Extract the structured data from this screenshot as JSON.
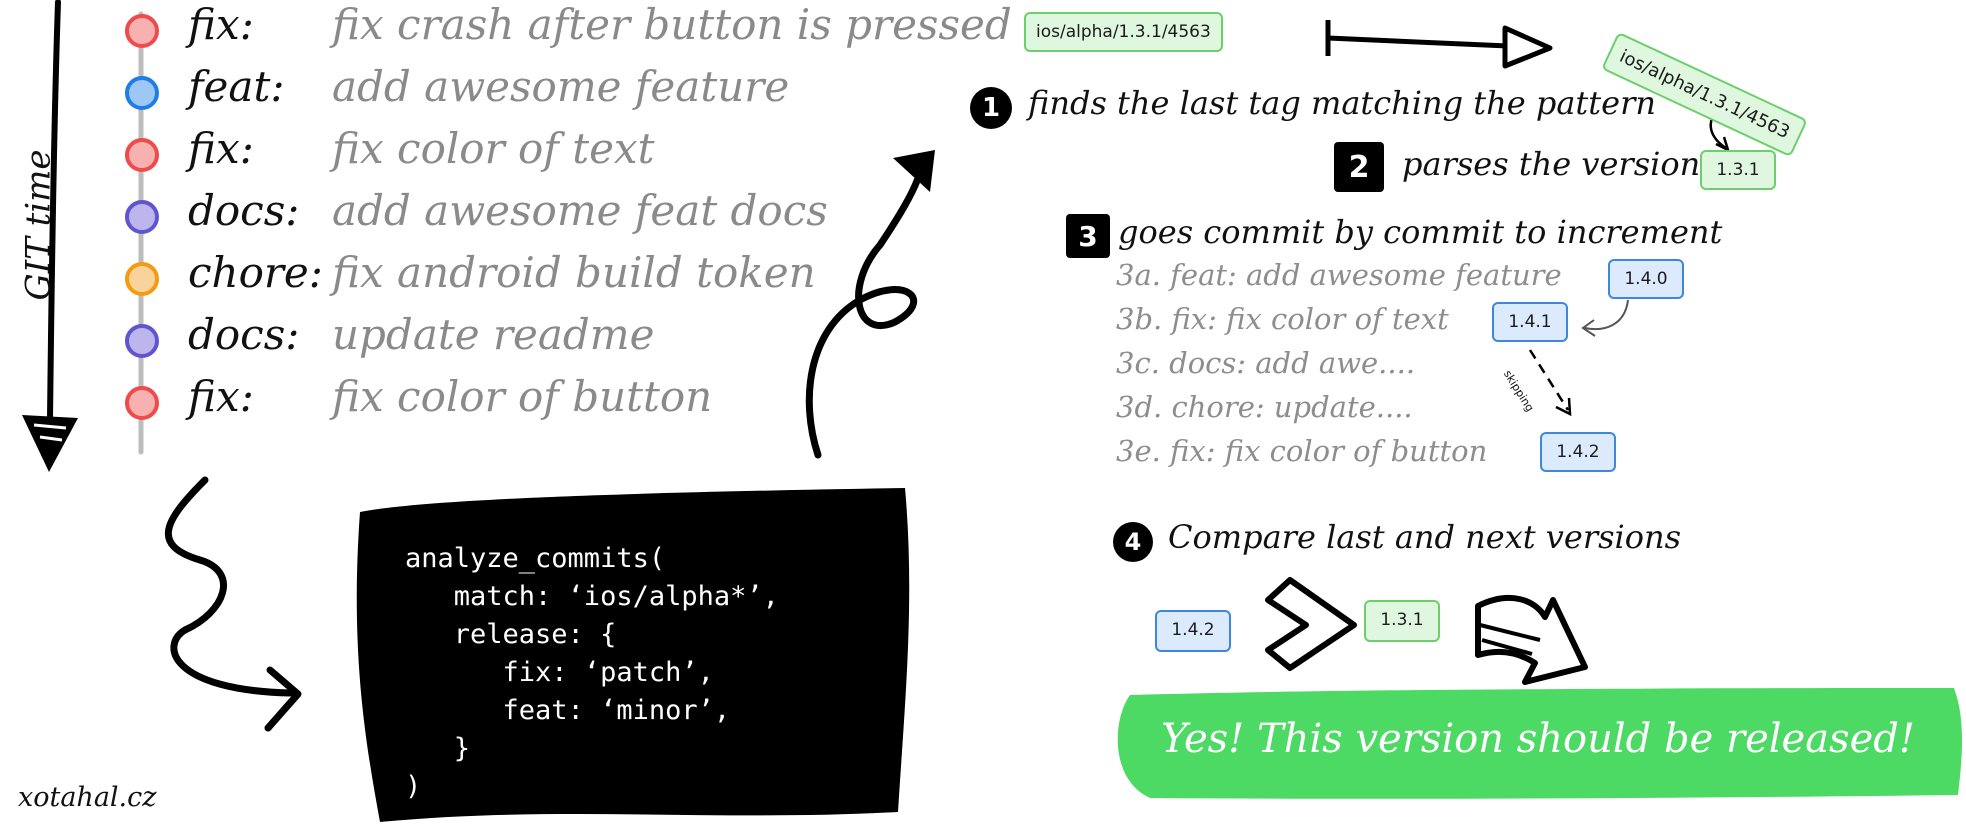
{
  "time_label": "GIT time",
  "commits": [
    {
      "type": "fix:",
      "message": "fix crash after button is pressed",
      "color": "#ef4b4b",
      "fill": "#f7b1b1"
    },
    {
      "type": "feat:",
      "message": "add awesome feature",
      "color": "#1f7de6",
      "fill": "#9dc7f5"
    },
    {
      "type": "fix:",
      "message": "fix color of text",
      "color": "#ef4b4b",
      "fill": "#f7b1b1"
    },
    {
      "type": "docs:",
      "message": "add awesome feat docs",
      "color": "#6155cf",
      "fill": "#bcb6ec"
    },
    {
      "type": "chore:",
      "message": "fix android build token",
      "color": "#f39c12",
      "fill": "#fad39a"
    },
    {
      "type": "docs:",
      "message": "update readme",
      "color": "#6155cf",
      "fill": "#bcb6ec"
    },
    {
      "type": "fix:",
      "message": "fix color of button",
      "color": "#ef4b4b",
      "fill": "#f7b1b1"
    }
  ],
  "last_tag": "ios/alpha/1.3.1/4563",
  "steps": {
    "s1": {
      "num": "1",
      "text": "finds the last tag matching the pattern"
    },
    "s2": {
      "num": "2",
      "text": "parses the version",
      "version": "1.3.1"
    },
    "s3": {
      "num": "3",
      "text": "goes commit by commit to increment",
      "items": [
        {
          "text": "3a. feat: add awesome feature",
          "version": "1.4.0"
        },
        {
          "text": "3b. fix: fix color of text",
          "version": "1.4.1"
        },
        {
          "text": "3c. docs: add awe...."
        },
        {
          "text": "3d. chore: update...."
        },
        {
          "text": "3e. fix: fix color of button",
          "version": "1.4.2"
        }
      ],
      "skipping_label": "skipping"
    },
    "s4": {
      "num": "4",
      "text": "Compare last and next versions",
      "next_version": "1.4.2",
      "last_version": "1.3.1"
    }
  },
  "code_lines": [
    "analyze_commits(",
    "   match: ‘ios/alpha*’,",
    "   release: {",
    "      fix: ‘patch’,",
    "      feat: ‘minor’,",
    "   }",
    ")"
  ],
  "result": "Yes! This version should be released!",
  "watermark": "xotahal.cz",
  "colors": {
    "green_banner": "#4cd964",
    "tag_green": "#6ccf6c",
    "tag_blue": "#3f86e0"
  }
}
